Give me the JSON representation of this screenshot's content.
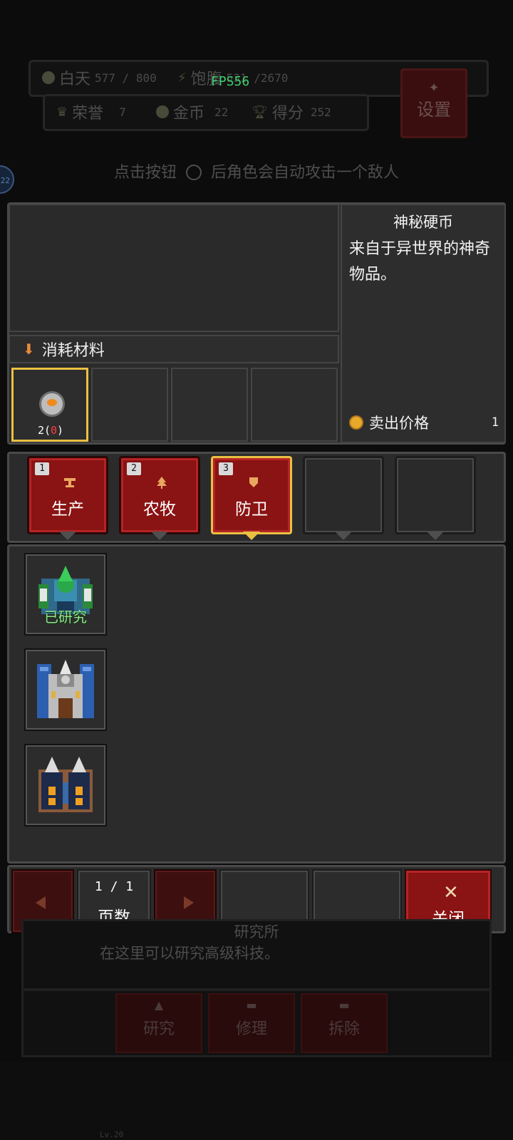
{
  "hud": {
    "day_label": "白天",
    "day_value": "577 / 800",
    "hunger_label": "饱腹",
    "hunger_value": "531 /2670",
    "fps": "FPS56",
    "honor_label": "荣誉",
    "honor_value": "7",
    "gold_label": "金币",
    "gold_value": "22",
    "score_label": "得分",
    "score_value": "252",
    "settings_label": "设置"
  },
  "side_badge": "22",
  "hint": {
    "before": "点击按钮",
    "after": "后角色会自动攻击一个敌人"
  },
  "materials": {
    "label": "消耗材料",
    "slots": [
      {
        "count_have": "2",
        "count_need": "0",
        "selected": true
      },
      {
        "empty": true
      },
      {
        "empty": true
      },
      {
        "empty": true
      }
    ]
  },
  "item_detail": {
    "name": "神秘硬币",
    "description": "来自于异世界的神奇物品。",
    "sell_label": "卖出价格",
    "sell_value": "1"
  },
  "tabs": [
    {
      "num": "1",
      "label": "生产",
      "icon": "anvil-icon",
      "selected": false
    },
    {
      "num": "2",
      "label": "农牧",
      "icon": "tree-icon",
      "selected": false
    },
    {
      "num": "3",
      "label": "防卫",
      "icon": "shield-icon",
      "selected": true
    },
    {
      "empty": true
    },
    {
      "empty": true
    }
  ],
  "buildings": [
    {
      "icon": "green-turret-icon",
      "status": "已研究"
    },
    {
      "icon": "blue-castle-icon"
    },
    {
      "icon": "twin-tower-icon"
    }
  ],
  "pager": {
    "current": "1",
    "total": "1",
    "separator": "/",
    "label": "页数"
  },
  "close_label": "关闭",
  "background": {
    "title": "研究所",
    "description": "在这里可以研究高级科技。",
    "actions": [
      "研究",
      "修理",
      "拆除"
    ],
    "floor_text": "Lv.20"
  },
  "colors": {
    "accent_gold": "#e9c043",
    "tab_red": "#8a1313",
    "panel": "#2b2b2b",
    "researched_green": "#8fe38f",
    "fps_green": "#3fcf6f"
  }
}
